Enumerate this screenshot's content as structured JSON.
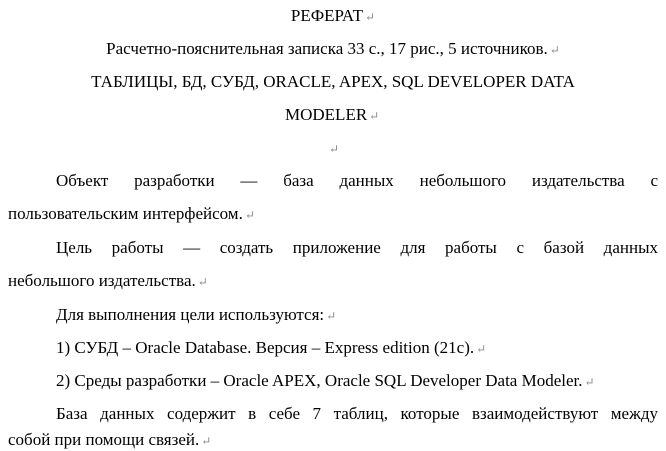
{
  "document": {
    "title": "РЕФЕРАТ",
    "summary": "Расчетно-пояснительная записка 33 с., 17 рис., 5 источников.",
    "keywords_line1": "ТАБЛИЦЫ, БД, СУБД, ORACLE, APEX, SQL DEVELOPER DATA",
    "keywords_line2": "MODELER",
    "object_line1": "Объект разработки — база данных небольшого издательства с",
    "object_line2": "пользовательским интерфейсом.",
    "goal_line1": "Цель работы — создать приложение для работы с базой данных",
    "goal_line2": "небольшого издательства.",
    "tools_intro": "Для выполнения цели используются:",
    "tool_1": "1) СУБД – Oracle Database. Версия – Express edition (21c).",
    "tool_2": "2) Среды разработки – Oracle APEX, Oracle SQL Developer Data Modeler.",
    "db_line1": "База данных содержит в себе 7 таблиц, которые взаимодействуют между",
    "db_line2": "собой при помощи связей.",
    "paragraph_mark": "↵"
  }
}
